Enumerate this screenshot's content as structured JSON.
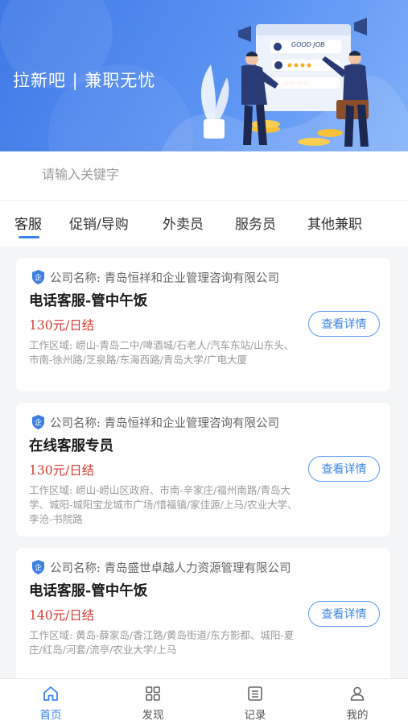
{
  "banner": {
    "title": "拉新吧 | 兼职无忧",
    "sign_text": "GOOD JOB"
  },
  "search": {
    "placeholder": "请输入关键字",
    "icon": "search-icon"
  },
  "tabs": [
    {
      "label": "客服",
      "active": true
    },
    {
      "label": "促销/导购",
      "active": false
    },
    {
      "label": "外卖员",
      "active": false
    },
    {
      "label": "服务员",
      "active": false
    },
    {
      "label": "其他兼职",
      "active": false
    }
  ],
  "jobs": [
    {
      "company": "公司名称:  青岛恒祥和企业管理咨询有限公司",
      "title": "电话客服-管中午饭",
      "pay": "130元/日结",
      "area": "工作区域:  崂山-青岛二中/啤酒城/石老人/汽车东站/山东头、市南-徐州路/芝泉路/东海西路/青岛大学/广电大厦",
      "button": "查看详情"
    },
    {
      "company": "公司名称:  青岛恒祥和企业管理咨询有限公司",
      "title": "在线客服专员",
      "pay": "130元/日结",
      "area": "工作区域:  崂山-崂山区政府、市南-辛家庄/福州南路/青岛大学、城阳-城阳宝龙城市广场/惜福镇/家佳源/上马/农业大学、李沧-书院路",
      "button": "查看详情"
    },
    {
      "company": "公司名称:  青岛盛世卓越人力资源管理有限公司",
      "title": "电话客服-管中午饭",
      "pay": "140元/日结",
      "area": "工作区域:  黄岛-薛家岛/香江路/黄岛街道/东方影都、城阳-夏庄/红岛/河套/流亭/农业大学/上马",
      "button": "查看详情"
    }
  ],
  "nav": [
    {
      "label": "首页",
      "icon": "home-icon",
      "active": true
    },
    {
      "label": "发现",
      "icon": "grid-icon",
      "active": false
    },
    {
      "label": "记录",
      "icon": "list-icon",
      "active": false
    },
    {
      "label": "我的",
      "icon": "user-icon",
      "active": false
    }
  ],
  "colors": {
    "accent": "#3b82f6",
    "pay": "#d93a35",
    "banner": "#4a84ec"
  }
}
